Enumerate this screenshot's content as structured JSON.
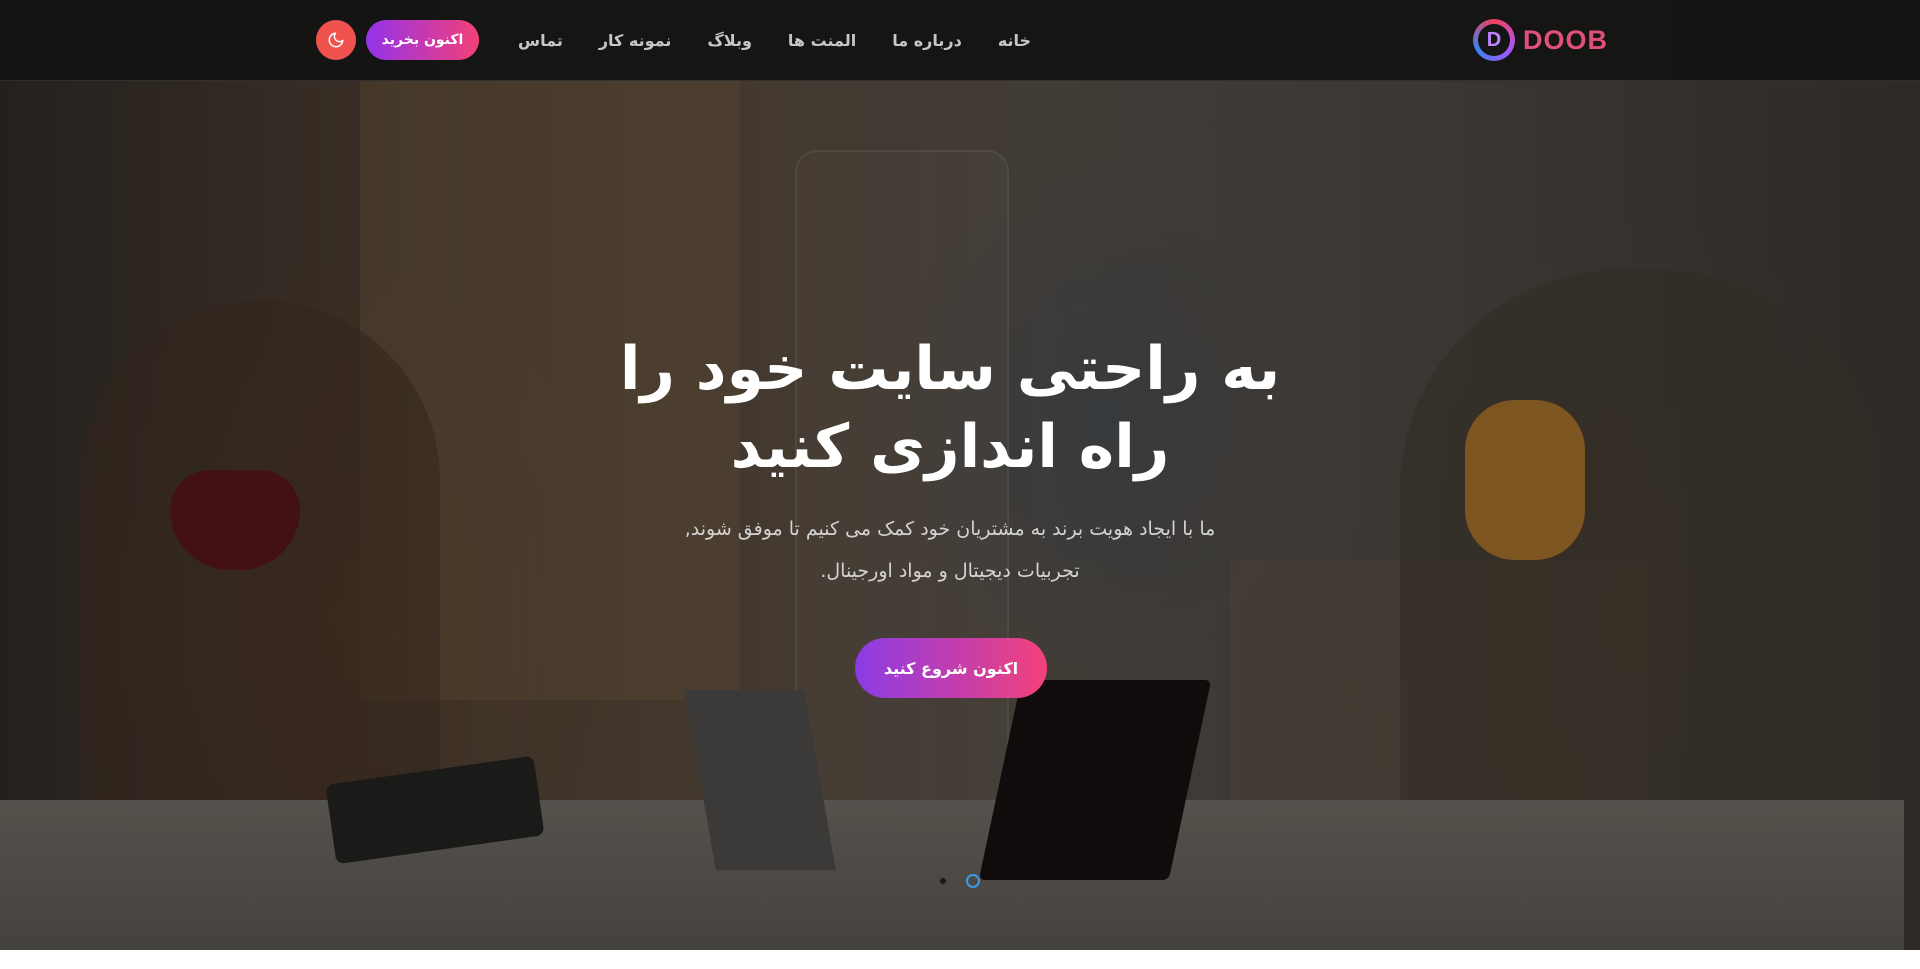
{
  "brand": {
    "logo_letter": "D",
    "name": "DOOB"
  },
  "nav": {
    "items": [
      {
        "label": "خانه"
      },
      {
        "label": "درباره ما"
      },
      {
        "label": "المنت ها"
      },
      {
        "label": "وبلاگ"
      },
      {
        "label": "نمونه کار"
      },
      {
        "label": "تماس"
      }
    ]
  },
  "header": {
    "buy_label": "اکنون بخرید",
    "theme_icon": "moon-icon"
  },
  "hero": {
    "title_line1": "به راحتی سایت خود را",
    "title_line2": "راه اندازی کنید",
    "subtitle_line1": "ما با ایجاد هویت برند به مشتریان خود کمک می کنیم تا موفق شوند,",
    "subtitle_line2": "تجربیات دیجیتال و مواد اورجینال.",
    "cta_label": "اکنون شروع کنید"
  },
  "slider": {
    "dot_count": 2,
    "active_index": 1
  },
  "colors": {
    "header_bg": "#121212",
    "accent_start": "#9333ea",
    "accent_end": "#f43f78",
    "theme_button": "#f0524e",
    "active_dot": "#3b9be8"
  }
}
